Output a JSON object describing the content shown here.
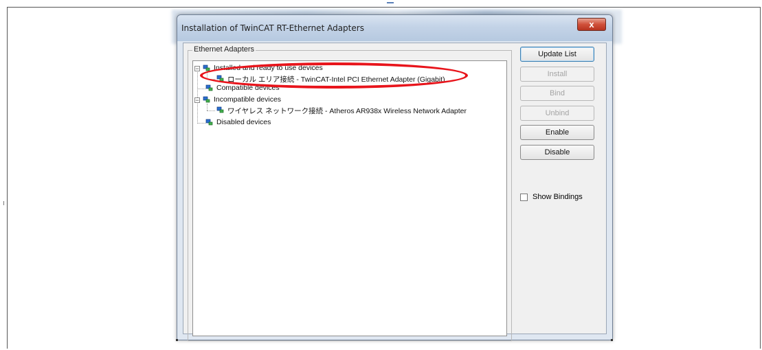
{
  "dialog": {
    "title": "Installation of TwinCAT RT-Ethernet Adapters",
    "close_label": "x"
  },
  "group": {
    "label": "Ethernet Adapters"
  },
  "tree": {
    "installed": {
      "expander": "−",
      "label": "Installed and ready to use devices",
      "children": [
        "ローカル エリア接続 - TwinCAT-Intel PCI Ethernet Adapter (Gigabit)"
      ]
    },
    "compatible": {
      "label": "Compatible devices"
    },
    "incompatible": {
      "expander": "−",
      "label": "Incompatible devices",
      "children": [
        "ワイヤレス ネットワーク接続 - Atheros AR938x Wireless Network Adapter"
      ]
    },
    "disabled": {
      "label": "Disabled devices"
    }
  },
  "buttons": {
    "update_list": "Update List",
    "install": "Install",
    "bind": "Bind",
    "unbind": "Unbind",
    "enable": "Enable",
    "disable": "Disable"
  },
  "options": {
    "show_bindings_label": "Show Bindings",
    "show_bindings_checked": false
  },
  "colors": {
    "highlight_ellipse": "#e8141b",
    "close_button": "#d0503a"
  }
}
